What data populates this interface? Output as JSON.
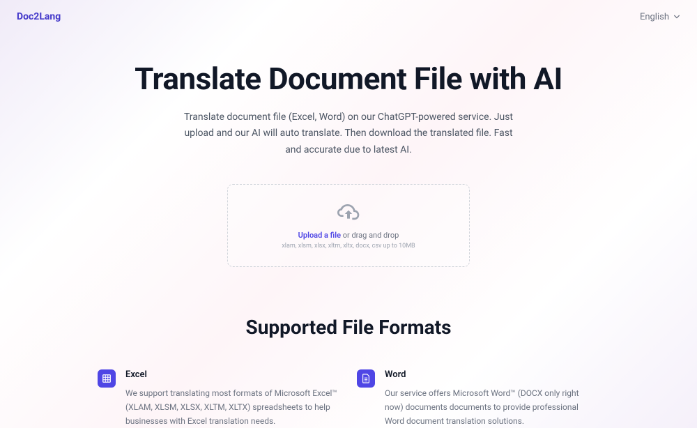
{
  "header": {
    "logo": "Doc2Lang",
    "language": "English"
  },
  "hero": {
    "title": "Translate Document File with AI",
    "subtitle": "Translate document file (Excel, Word) on our ChatGPT-powered service. Just upload and our AI will auto translate. Then download the translated file. Fast and accurate due to latest AI."
  },
  "upload": {
    "link_text": "Upload a file",
    "text_suffix": " or drag and drop",
    "hint": "xlam, xlsm, xlsx, xltm, xltx, docx, csv up to 10MB"
  },
  "formats": {
    "title": "Supported File Formats",
    "items": [
      {
        "name": "Excel",
        "description": "We support translating most formats of Microsoft Excel™ (XLAM, XLSM, XLSX, XLTM, XLTX) spreadsheets to help businesses with Excel translation needs."
      },
      {
        "name": "Word",
        "description": "Our service offers Microsoft Word™ (DOCX only right now) documents documents to provide professional Word document translation solutions."
      }
    ]
  }
}
